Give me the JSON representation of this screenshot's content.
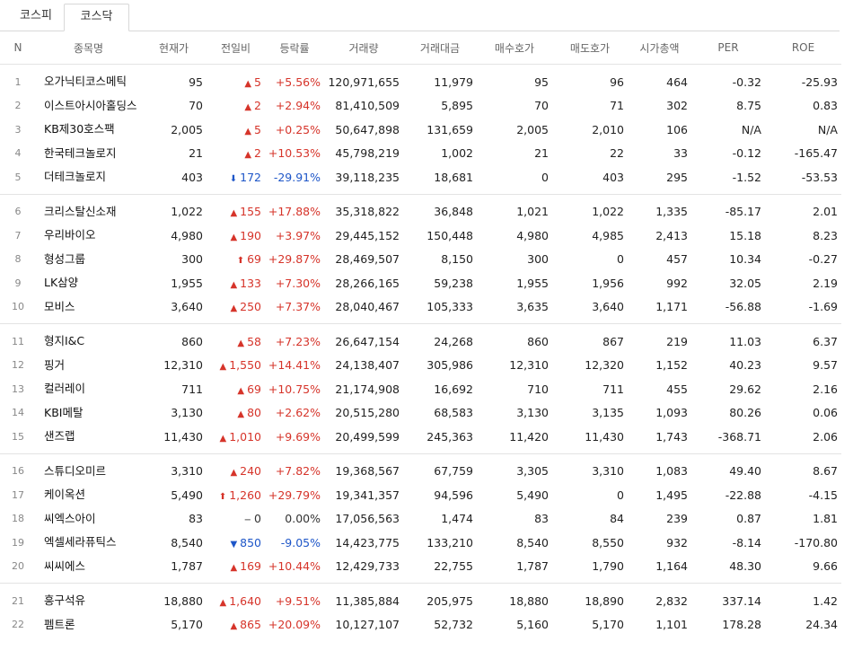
{
  "tabs": [
    {
      "label": "코스피"
    },
    {
      "label": "코스닥"
    }
  ],
  "active_tab": "코스닥",
  "columns": [
    "N",
    "종목명",
    "현재가",
    "전일비",
    "등락률",
    "거래량",
    "거래대금",
    "매수호가",
    "매도호가",
    "시가총액",
    "PER",
    "ROE"
  ],
  "colors": {
    "up": "#d6342a",
    "down": "#1e56c8"
  },
  "groups": [
    [
      {
        "n": "1",
        "name": "오가닉티코스메틱",
        "price": "95",
        "dir": "up",
        "arrow": "▲",
        "change": "5",
        "rate": "+5.56%",
        "volume": "120,971,655",
        "amount": "11,979",
        "bid": "95",
        "ask": "96",
        "cap": "464",
        "per": "-0.32",
        "roe": "-25.93"
      },
      {
        "n": "2",
        "name": "이스트아시아홀딩스",
        "price": "70",
        "dir": "up",
        "arrow": "▲",
        "change": "2",
        "rate": "+2.94%",
        "volume": "81,410,509",
        "amount": "5,895",
        "bid": "70",
        "ask": "71",
        "cap": "302",
        "per": "8.75",
        "roe": "0.83"
      },
      {
        "n": "3",
        "name": "KB제30호스팩",
        "price": "2,005",
        "dir": "up",
        "arrow": "▲",
        "change": "5",
        "rate": "+0.25%",
        "volume": "50,647,898",
        "amount": "131,659",
        "bid": "2,005",
        "ask": "2,010",
        "cap": "106",
        "per": "N/A",
        "roe": "N/A"
      },
      {
        "n": "4",
        "name": "한국테크놀로지",
        "price": "21",
        "dir": "up",
        "arrow": "▲",
        "change": "2",
        "rate": "+10.53%",
        "volume": "45,798,219",
        "amount": "1,002",
        "bid": "21",
        "ask": "22",
        "cap": "33",
        "per": "-0.12",
        "roe": "-165.47"
      },
      {
        "n": "5",
        "name": "더테크놀로지",
        "price": "403",
        "dir": "dn",
        "arrow": "⬇",
        "change": "172",
        "rate": "-29.91%",
        "volume": "39,118,235",
        "amount": "18,681",
        "bid": "0",
        "ask": "403",
        "cap": "295",
        "per": "-1.52",
        "roe": "-53.53"
      }
    ],
    [
      {
        "n": "6",
        "name": "크리스탈신소재",
        "price": "1,022",
        "dir": "up",
        "arrow": "▲",
        "change": "155",
        "rate": "+17.88%",
        "volume": "35,318,822",
        "amount": "36,848",
        "bid": "1,021",
        "ask": "1,022",
        "cap": "1,335",
        "per": "-85.17",
        "roe": "2.01"
      },
      {
        "n": "7",
        "name": "우리바이오",
        "price": "4,980",
        "dir": "up",
        "arrow": "▲",
        "change": "190",
        "rate": "+3.97%",
        "volume": "29,445,152",
        "amount": "150,448",
        "bid": "4,980",
        "ask": "4,985",
        "cap": "2,413",
        "per": "15.18",
        "roe": "8.23"
      },
      {
        "n": "8",
        "name": "형성그룹",
        "price": "300",
        "dir": "up",
        "arrow": "⬆",
        "change": "69",
        "rate": "+29.87%",
        "volume": "28,469,507",
        "amount": "8,150",
        "bid": "300",
        "ask": "0",
        "cap": "457",
        "per": "10.34",
        "roe": "-0.27"
      },
      {
        "n": "9",
        "name": "LK삼양",
        "price": "1,955",
        "dir": "up",
        "arrow": "▲",
        "change": "133",
        "rate": "+7.30%",
        "volume": "28,266,165",
        "amount": "59,238",
        "bid": "1,955",
        "ask": "1,956",
        "cap": "992",
        "per": "32.05",
        "roe": "2.19"
      },
      {
        "n": "10",
        "name": "모비스",
        "price": "3,640",
        "dir": "up",
        "arrow": "▲",
        "change": "250",
        "rate": "+7.37%",
        "volume": "28,040,467",
        "amount": "105,333",
        "bid": "3,635",
        "ask": "3,640",
        "cap": "1,171",
        "per": "-56.88",
        "roe": "-1.69"
      }
    ],
    [
      {
        "n": "11",
        "name": "형지I&C",
        "price": "860",
        "dir": "up",
        "arrow": "▲",
        "change": "58",
        "rate": "+7.23%",
        "volume": "26,647,154",
        "amount": "24,268",
        "bid": "860",
        "ask": "867",
        "cap": "219",
        "per": "11.03",
        "roe": "6.37"
      },
      {
        "n": "12",
        "name": "핑거",
        "price": "12,310",
        "dir": "up",
        "arrow": "▲",
        "change": "1,550",
        "rate": "+14.41%",
        "volume": "24,138,407",
        "amount": "305,986",
        "bid": "12,310",
        "ask": "12,320",
        "cap": "1,152",
        "per": "40.23",
        "roe": "9.57"
      },
      {
        "n": "13",
        "name": "컬러레이",
        "price": "711",
        "dir": "up",
        "arrow": "▲",
        "change": "69",
        "rate": "+10.75%",
        "volume": "21,174,908",
        "amount": "16,692",
        "bid": "710",
        "ask": "711",
        "cap": "455",
        "per": "29.62",
        "roe": "2.16"
      },
      {
        "n": "14",
        "name": "KBI메탈",
        "price": "3,130",
        "dir": "up",
        "arrow": "▲",
        "change": "80",
        "rate": "+2.62%",
        "volume": "20,515,280",
        "amount": "68,583",
        "bid": "3,130",
        "ask": "3,135",
        "cap": "1,093",
        "per": "80.26",
        "roe": "0.06"
      },
      {
        "n": "15",
        "name": "샌즈랩",
        "price": "11,430",
        "dir": "up",
        "arrow": "▲",
        "change": "1,010",
        "rate": "+9.69%",
        "volume": "20,499,599",
        "amount": "245,363",
        "bid": "11,420",
        "ask": "11,430",
        "cap": "1,743",
        "per": "-368.71",
        "roe": "2.06"
      }
    ],
    [
      {
        "n": "16",
        "name": "스튜디오미르",
        "price": "3,310",
        "dir": "up",
        "arrow": "▲",
        "change": "240",
        "rate": "+7.82%",
        "volume": "19,368,567",
        "amount": "67,759",
        "bid": "3,305",
        "ask": "3,310",
        "cap": "1,083",
        "per": "49.40",
        "roe": "8.67"
      },
      {
        "n": "17",
        "name": "케이옥션",
        "price": "5,490",
        "dir": "up",
        "arrow": "⬆",
        "change": "1,260",
        "rate": "+29.79%",
        "volume": "19,341,357",
        "amount": "94,596",
        "bid": "5,490",
        "ask": "0",
        "cap": "1,495",
        "per": "-22.88",
        "roe": "-4.15"
      },
      {
        "n": "18",
        "name": "씨엑스아이",
        "price": "83",
        "dir": "fl",
        "arrow": "−",
        "change": "0",
        "rate": "0.00%",
        "volume": "17,056,563",
        "amount": "1,474",
        "bid": "83",
        "ask": "84",
        "cap": "239",
        "per": "0.87",
        "roe": "1.81"
      },
      {
        "n": "19",
        "name": "엑셀세라퓨틱스",
        "price": "8,540",
        "dir": "dn",
        "arrow": "▼",
        "change": "850",
        "rate": "-9.05%",
        "volume": "14,423,775",
        "amount": "133,210",
        "bid": "8,540",
        "ask": "8,550",
        "cap": "932",
        "per": "-8.14",
        "roe": "-170.80"
      },
      {
        "n": "20",
        "name": "씨씨에스",
        "price": "1,787",
        "dir": "up",
        "arrow": "▲",
        "change": "169",
        "rate": "+10.44%",
        "volume": "12,429,733",
        "amount": "22,755",
        "bid": "1,787",
        "ask": "1,790",
        "cap": "1,164",
        "per": "48.30",
        "roe": "9.66"
      }
    ],
    [
      {
        "n": "21",
        "name": "흥구석유",
        "price": "18,880",
        "dir": "up",
        "arrow": "▲",
        "change": "1,640",
        "rate": "+9.51%",
        "volume": "11,385,884",
        "amount": "205,975",
        "bid": "18,880",
        "ask": "18,890",
        "cap": "2,832",
        "per": "337.14",
        "roe": "1.42"
      },
      {
        "n": "22",
        "name": "펨트론",
        "price": "5,170",
        "dir": "up",
        "arrow": "▲",
        "change": "865",
        "rate": "+20.09%",
        "volume": "10,127,107",
        "amount": "52,732",
        "bid": "5,160",
        "ask": "5,170",
        "cap": "1,101",
        "per": "178.28",
        "roe": "24.34"
      }
    ]
  ]
}
